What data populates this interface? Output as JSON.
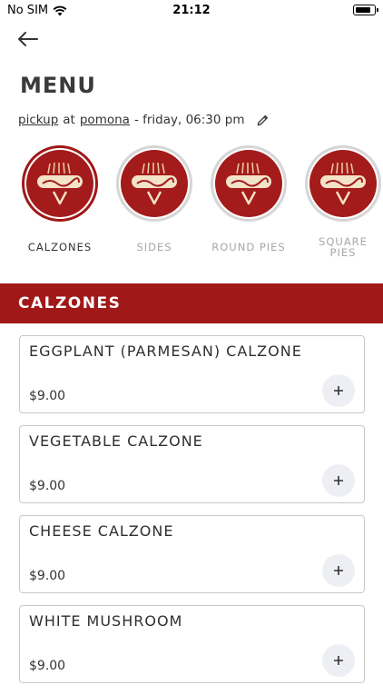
{
  "status_bar": {
    "carrier": "No SIM",
    "time": "21:12"
  },
  "header": {
    "title": "MENU"
  },
  "order": {
    "mode": "pickup",
    "at": "at",
    "location": "pomona",
    "when": "- friday, 06:30 pm"
  },
  "categories": [
    {
      "label": "CALZONES",
      "active": true
    },
    {
      "label": "SIDES",
      "active": false
    },
    {
      "label": "ROUND PIES",
      "active": false
    },
    {
      "label": "SQUARE\nPIES",
      "active": false
    }
  ],
  "section": {
    "title": "CALZONES"
  },
  "items": [
    {
      "name": "EGGPLANT (PARMESAN) CALZONE",
      "price": "$9.00"
    },
    {
      "name": "VEGETABLE CALZONE",
      "price": "$9.00"
    },
    {
      "name": "CHEESE CALZONE",
      "price": "$9.00"
    },
    {
      "name": "WHITE MUSHROOM",
      "price": "$9.00"
    }
  ],
  "colors": {
    "brand": "#a01818",
    "inactive_text": "#a7a7a7"
  },
  "icons": {
    "back": "arrow-left-icon",
    "edit": "pencil-icon",
    "add": "plus-icon",
    "wifi": "wifi-icon",
    "battery": "battery-icon"
  }
}
